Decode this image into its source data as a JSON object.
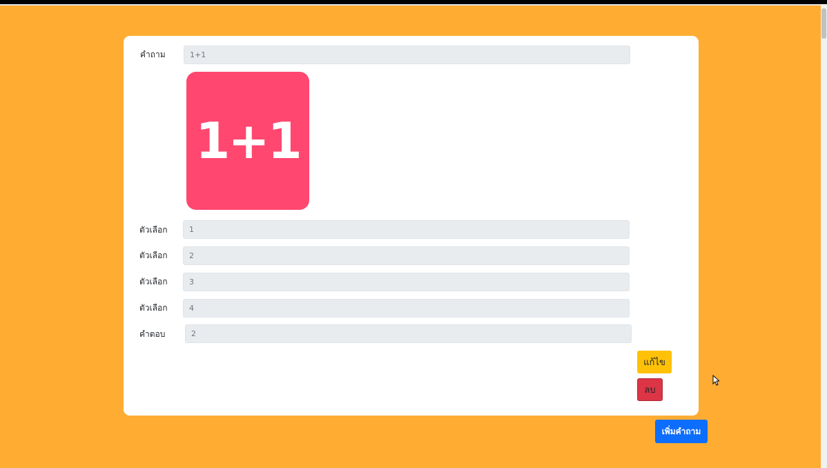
{
  "colors": {
    "background": "#ffac33",
    "card": "#ffffff",
    "input_bg": "#e9ecef",
    "image_bg": "#ff476f",
    "edit_button": "#ffc107",
    "delete_button": "#dc3545",
    "add_button": "#0d6efd"
  },
  "question": {
    "label": "คำถาม",
    "value": "1+1",
    "image_text": "1+1"
  },
  "choices": [
    {
      "label": "ตัวเลือก",
      "value": "1"
    },
    {
      "label": "ตัวเลือก",
      "value": "2"
    },
    {
      "label": "ตัวเลือก",
      "value": "3"
    },
    {
      "label": "ตัวเลือก",
      "value": "4"
    }
  ],
  "answer": {
    "label": "คำตอบ",
    "value": "2"
  },
  "buttons": {
    "edit": "แก้ไข",
    "delete": "ลบ",
    "add_question": "เพิ่มคำถาม"
  },
  "icons": {
    "cursor": "mouse-pointer-icon"
  }
}
